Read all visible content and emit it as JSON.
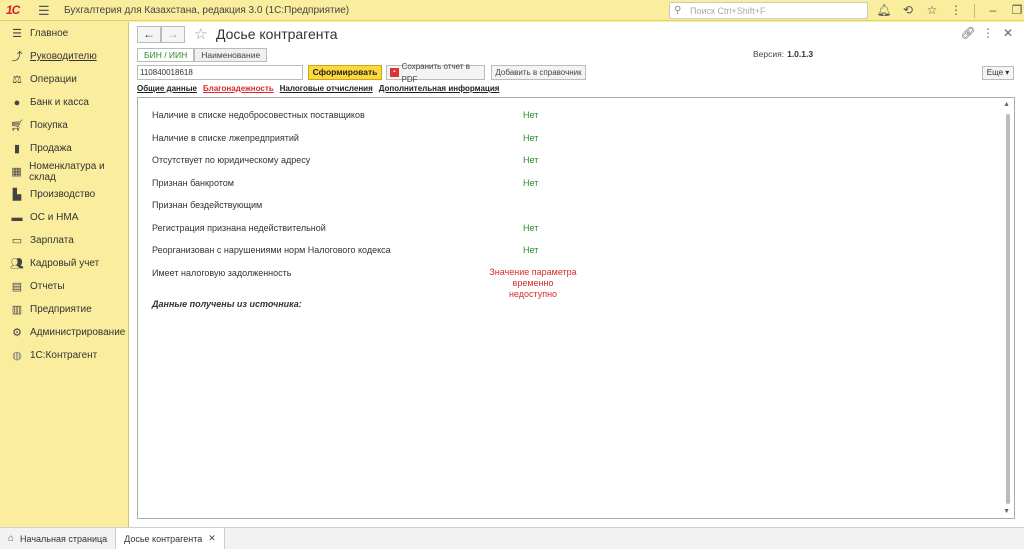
{
  "titlebar": {
    "logo": "1С",
    "app_title": "Бухгалтерия для Казахстана, редакция 3.0  (1С:Предприятие)",
    "search_placeholder": "Поиск Ctrl+Shift+F"
  },
  "sidebar": {
    "items": [
      {
        "label": "Главное",
        "icon": "menu-icon"
      },
      {
        "label": "Руководителю",
        "icon": "chart-icon"
      },
      {
        "label": "Операции",
        "icon": "scales-icon"
      },
      {
        "label": "Банк и касса",
        "icon": "coin-icon"
      },
      {
        "label": "Покупка",
        "icon": "cart-icon"
      },
      {
        "label": "Продажа",
        "icon": "bag-icon"
      },
      {
        "label": "Номенклатура и склад",
        "icon": "warehouse-icon"
      },
      {
        "label": "Производство",
        "icon": "factory-icon"
      },
      {
        "label": "ОС и НМА",
        "icon": "truck-icon"
      },
      {
        "label": "Зарплата",
        "icon": "money-icon"
      },
      {
        "label": "Кадровый учет",
        "icon": "people-icon"
      },
      {
        "label": "Отчеты",
        "icon": "report-icon"
      },
      {
        "label": "Предприятие",
        "icon": "building-icon"
      },
      {
        "label": "Администрирование",
        "icon": "gear-icon"
      },
      {
        "label": "1С:Контрагент",
        "icon": "contractor-icon"
      }
    ]
  },
  "form": {
    "title": "Досье контрагента",
    "version_label": "Версия:",
    "version_value": "1.0.1.3",
    "search_tabs": [
      "БИН / ИИН",
      "Наименование"
    ],
    "inn_value": "110840018618",
    "btn_generate": "Сформировать",
    "btn_pdf": "Сохранить отчет в PDF",
    "btn_add": "Добавить в справочник",
    "btn_more": "Еще ▾",
    "sections": [
      "Общие данные",
      "Благонадежность",
      "Налоговые отчисления",
      "Дополнительная информация"
    ]
  },
  "checks": [
    {
      "label": "Наличие в списке недобросовестных поставщиков",
      "value": "Нет"
    },
    {
      "label": "Наличие в списке лжепредприятий",
      "value": "Нет"
    },
    {
      "label": "Отсутствует по юридическому адресу",
      "value": "Нет"
    },
    {
      "label": "Признан банкротом",
      "value": "Нет"
    },
    {
      "label": "Признан бездействующим",
      "value": ""
    },
    {
      "label": "Регистрация признана недействительной",
      "value": "Нет"
    },
    {
      "label": "Реорганизован с нарушениями норм Налогового кодекса",
      "value": "Нет"
    },
    {
      "label": "Имеет налоговую задолженность",
      "value": "Значение параметра временно недоступно"
    }
  ],
  "source_label": "Данные получены из источника:",
  "bottom_tabs": {
    "home": "Начальная страница",
    "dossier": "Досье контрагента"
  }
}
